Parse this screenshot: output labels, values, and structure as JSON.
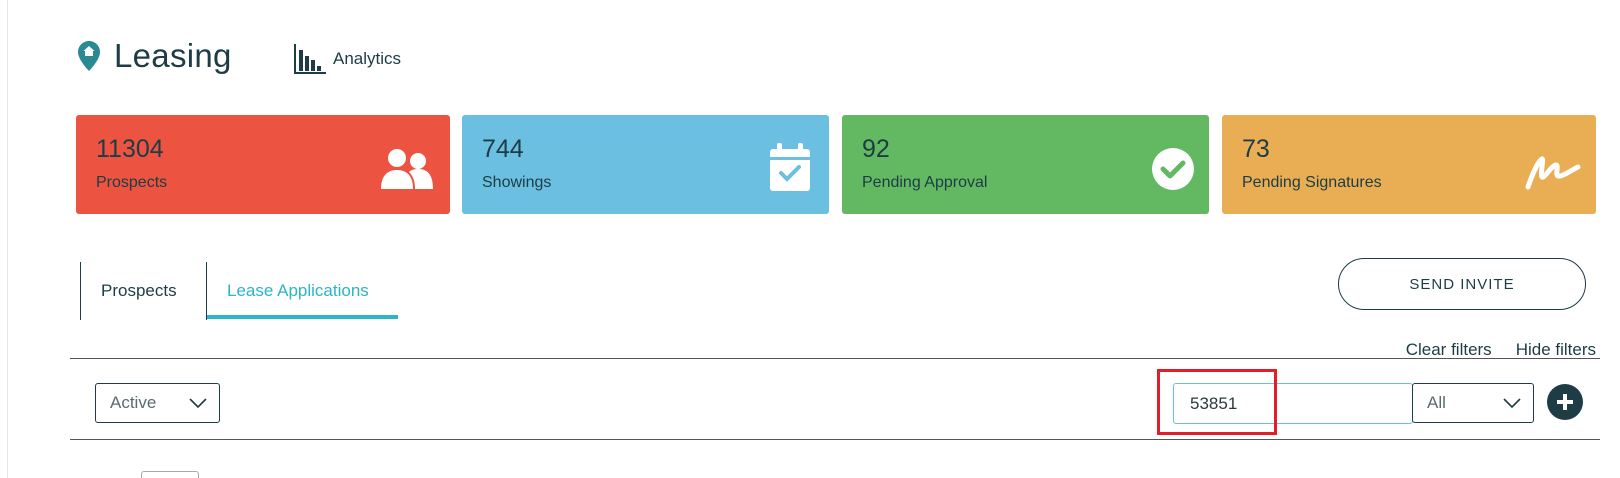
{
  "header": {
    "title": "Leasing",
    "analytics_label": "Analytics"
  },
  "cards": [
    {
      "value": "11304",
      "label": "Prospects",
      "color": "#ec5441",
      "icon": "users-icon"
    },
    {
      "value": "744",
      "label": "Showings",
      "color": "#6bbfe0",
      "icon": "calendar-check-icon"
    },
    {
      "value": "92",
      "label": "Pending Approval",
      "color": "#62b961",
      "icon": "check-circle-icon"
    },
    {
      "value": "73",
      "label": "Pending Signatures",
      "color": "#e9ae54",
      "icon": "signature-icon"
    }
  ],
  "tabs": [
    {
      "label": "Prospects",
      "active": false
    },
    {
      "label": "Lease Applications",
      "active": true
    }
  ],
  "actions": {
    "send_invite": "SEND INVITE"
  },
  "filters": {
    "clear_label": "Clear filters",
    "hide_label": "Hide filters",
    "status_value": "Active",
    "search_value": "53851",
    "type_value": "All"
  },
  "colors": {
    "primary": "#1d3c45",
    "accent": "#2cb5c4",
    "highlight": "#e41e26"
  }
}
